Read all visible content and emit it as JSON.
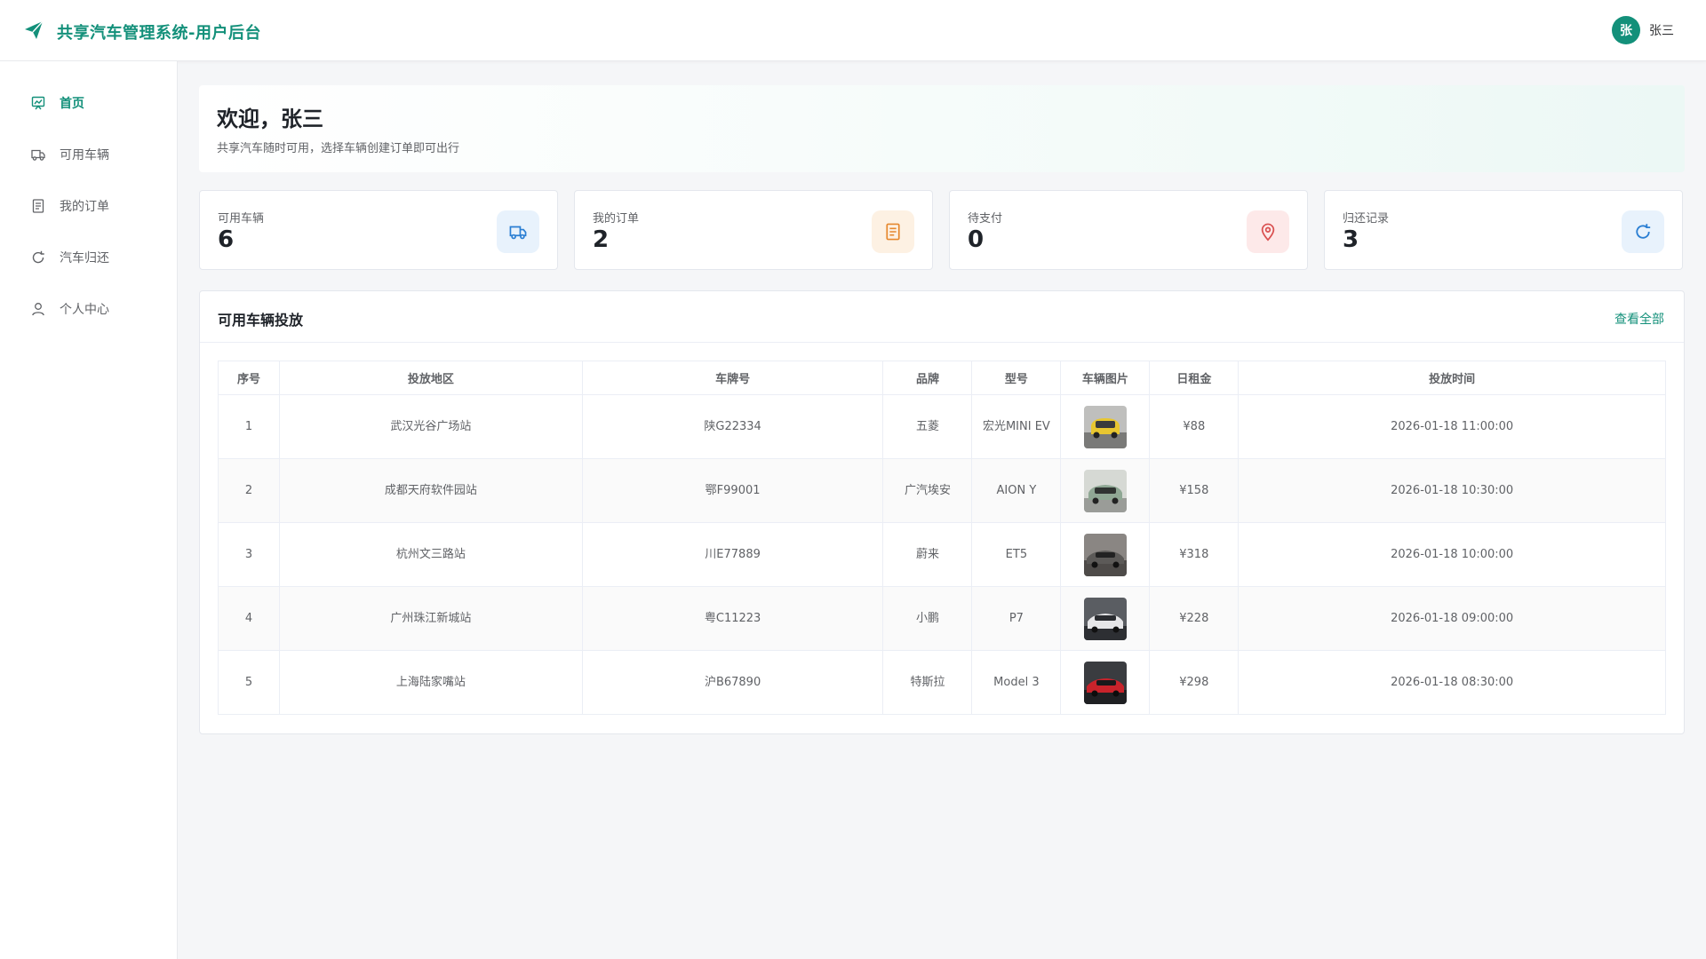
{
  "header": {
    "app_title": "共享汽车管理系统-用户后台",
    "logo_icon": "paper-plane-icon",
    "user": {
      "avatar_text": "张",
      "name": "张三"
    },
    "brand_color": "#13907a"
  },
  "sidebar": {
    "items": [
      {
        "label": "首页",
        "icon": "dashboard-icon",
        "active": true
      },
      {
        "label": "可用车辆",
        "icon": "truck-icon",
        "active": false
      },
      {
        "label": "我的订单",
        "icon": "document-icon",
        "active": false
      },
      {
        "label": "汽车归还",
        "icon": "refresh-icon",
        "active": false
      },
      {
        "label": "个人中心",
        "icon": "user-icon",
        "active": false
      }
    ]
  },
  "welcome": {
    "title": "欢迎，张三",
    "subtitle": "共享汽车随时可用，选择车辆创建订单即可出行"
  },
  "stats": [
    {
      "label": "可用车辆",
      "value": "6",
      "icon": "truck-icon",
      "color": "#2b7fd3",
      "bg": "#e8f2fc"
    },
    {
      "label": "我的订单",
      "value": "2",
      "icon": "document-icon",
      "color": "#e6882e",
      "bg": "#fdf1e3"
    },
    {
      "label": "待支付",
      "value": "0",
      "icon": "location-pin-icon",
      "color": "#d94f4f",
      "bg": "#fde9e9"
    },
    {
      "label": "归还记录",
      "value": "3",
      "icon": "refresh-icon",
      "color": "#2b7fd3",
      "bg": "#e8f2fc"
    }
  ],
  "vehicles": {
    "title": "可用车辆投放",
    "view_all": "查看全部",
    "columns": [
      "序号",
      "投放地区",
      "车牌号",
      "品牌",
      "型号",
      "车辆图片",
      "日租金",
      "投放时间"
    ],
    "rows": [
      {
        "no": "1",
        "region": "武汉光谷广场站",
        "plate": "陕G22334",
        "brand": "五菱",
        "model": "宏光MINI EV",
        "photo_color": "#e8c630",
        "rent": "¥88",
        "time": "2026-01-18 11:00:00"
      },
      {
        "no": "2",
        "region": "成都天府软件园站",
        "plate": "鄂F99001",
        "brand": "广汽埃安",
        "model": "AION Y",
        "photo_color": "#8fa894",
        "rent": "¥158",
        "time": "2026-01-18 10:30:00"
      },
      {
        "no": "3",
        "region": "杭州文三路站",
        "plate": "川E77889",
        "brand": "蔚来",
        "model": "ET5",
        "photo_color": "#5c5a58",
        "rent": "¥318",
        "time": "2026-01-18 10:00:00"
      },
      {
        "no": "4",
        "region": "广州珠江新城站",
        "plate": "粤C11223",
        "brand": "小鹏",
        "model": "P7",
        "photo_color": "#e6e6e8",
        "rent": "¥228",
        "time": "2026-01-18 09:00:00"
      },
      {
        "no": "5",
        "region": "上海陆家嘴站",
        "plate": "沪B67890",
        "brand": "特斯拉",
        "model": "Model 3",
        "photo_color": "#c8232b",
        "rent": "¥298",
        "time": "2026-01-18 08:30:00"
      }
    ]
  }
}
